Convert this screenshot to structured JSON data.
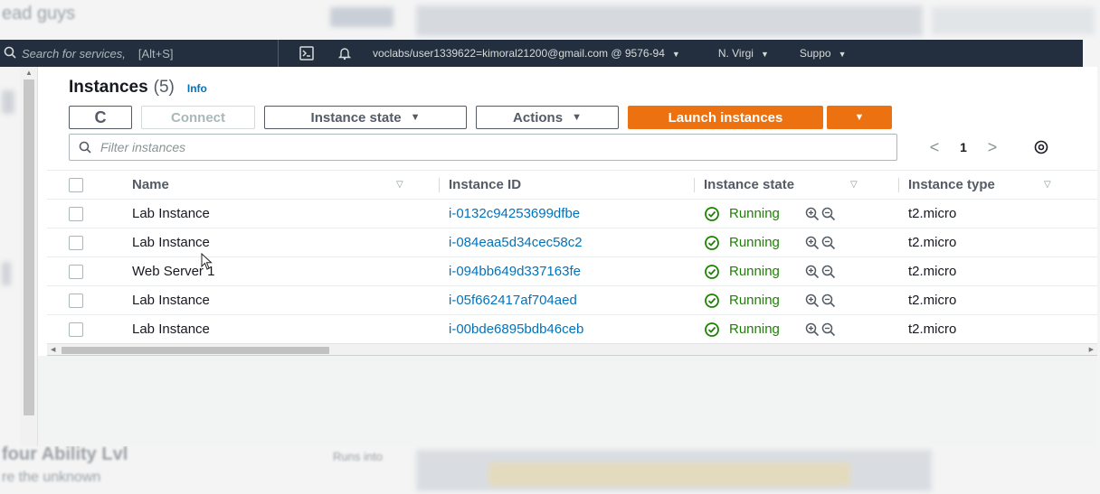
{
  "background": {
    "top_left_text": "ead guys",
    "bottom_left_text": "four Ability Lvl",
    "bottom_left_sub": "re the unknown",
    "bottom_mid_text": "Runs into"
  },
  "topnav": {
    "search_placeholder": "Search for services,",
    "search_shortcut": "[Alt+S]",
    "account": "voclabs/user1339622=kimoral21200@gmail.com @ 9576-94",
    "region": "N. Virgi",
    "support": "Suppo",
    "caret_glyph": "▼"
  },
  "header": {
    "title": "Instances",
    "count": "(5)",
    "info": "Info"
  },
  "toolbar": {
    "refresh_glyph": "C",
    "connect_label": "Connect",
    "instance_state_label": "Instance state",
    "actions_label": "Actions",
    "launch_label": "Launch instances",
    "caret_glyph": "▼"
  },
  "filter": {
    "placeholder": "Filter instances"
  },
  "pager": {
    "prev": "<",
    "page": "1",
    "next": ">"
  },
  "table": {
    "columns": {
      "name": "Name",
      "instance_id": "Instance ID",
      "instance_state": "Instance state",
      "instance_type": "Instance type"
    },
    "sort_glyph": "▽",
    "rows": [
      {
        "name": "Lab Instance",
        "id": "i-0132c94253699dfbe",
        "state": "Running",
        "type": "t2.micro"
      },
      {
        "name": "Lab Instance",
        "id": "i-084eaa5d34cec58c2",
        "state": "Running",
        "type": "t2.micro"
      },
      {
        "name": "Web Server 1",
        "id": "i-094bb649d337163fe",
        "state": "Running",
        "type": "t2.micro"
      },
      {
        "name": "Lab Instance",
        "id": "i-05f662417af704aed",
        "state": "Running",
        "type": "t2.micro"
      },
      {
        "name": "Lab Instance",
        "id": "i-00bde6895bdb46ceb",
        "state": "Running",
        "type": "t2.micro"
      }
    ]
  },
  "colors": {
    "primary": "#ec7211",
    "link": "#0073bb",
    "running": "#1d8102",
    "nav": "#232f3e"
  },
  "icons": {
    "search": "search-icon",
    "cloudshell": "cloudshell-icon",
    "bell": "bell-icon",
    "gear": "gear-icon",
    "status_ok": "check-circle-icon",
    "zoom_in": "zoom-in-icon",
    "zoom_out": "zoom-out-icon"
  }
}
